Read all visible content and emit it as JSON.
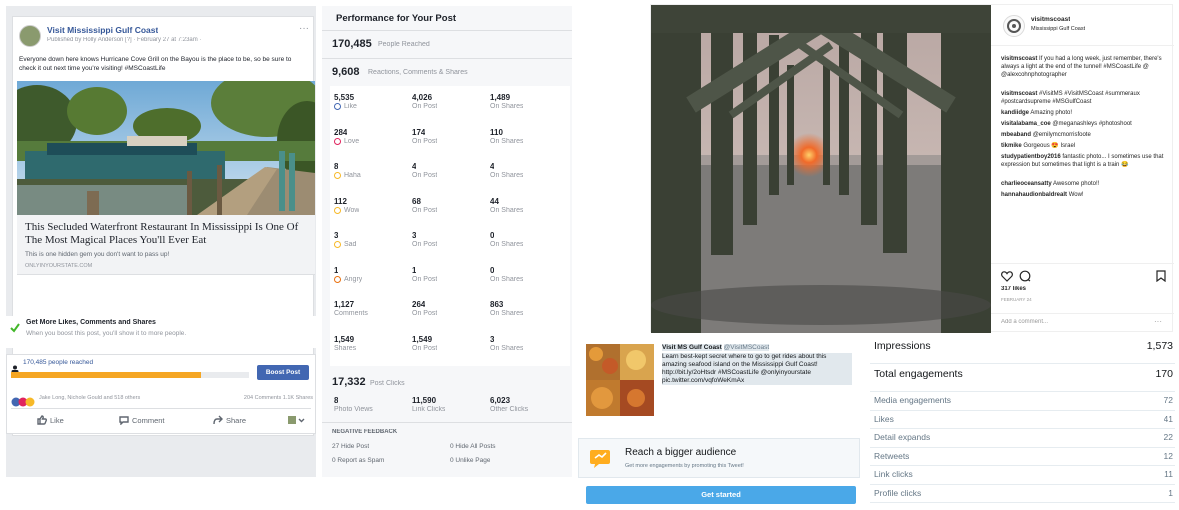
{
  "facebook": {
    "page_name": "Visit Mississippi Gulf Coast",
    "byline": "Published by Holly Anderson [?] · February 27 at 7:23am · ",
    "post_text": "Everyone down here knows Hurricane Cove Grill on the Bayou is the place to be, so be sure to check it out next time you're visiting! #MSCoastLife",
    "link_title": "This Secluded Waterfront Restaurant In Mississippi Is One Of The Most Magical Places You'll Ever Eat",
    "link_desc": "This is one hidden gem you don't want to pass up!",
    "link_domain": "ONLYINYOURSTATE.COM",
    "promo_title": "Get More Likes, Comments and Shares",
    "promo_desc": "When you boost this post, you'll show it to more people.",
    "reach_text": "170,485 people reached",
    "boost_label": "Boost Post",
    "reactions_text": "Jake Long, Nichole Gould and 518 others",
    "comments_text": "204 Comments 1.1K Shares",
    "like_label": "Like",
    "comment_label": "Comment",
    "share_label": "Share",
    "reach_progress_pct": 80
  },
  "performance": {
    "header": "Performance for Your Post",
    "reached_value": "170,485",
    "reached_label": "People Reached",
    "engaged_value": "9,608",
    "engaged_label": "Reactions, Comments & Shares",
    "rows": [
      {
        "v1": "5,535",
        "l1": "Like",
        "v2": "4,026",
        "l2": "On Post",
        "v3": "1,489",
        "l3": "On Shares",
        "color": "#4267b2",
        "icon": "like-icon"
      },
      {
        "v1": "284",
        "l1": "Love",
        "v2": "174",
        "l2": "On Post",
        "v3": "110",
        "l3": "On Shares",
        "color": "#e0245e",
        "icon": "love-icon"
      },
      {
        "v1": "8",
        "l1": "Haha",
        "v2": "4",
        "l2": "On Post",
        "v3": "4",
        "l3": "On Shares",
        "color": "#f7b928",
        "icon": "haha-icon"
      },
      {
        "v1": "112",
        "l1": "Wow",
        "v2": "68",
        "l2": "On Post",
        "v3": "44",
        "l3": "On Shares",
        "color": "#f7b928",
        "icon": "wow-icon"
      },
      {
        "v1": "3",
        "l1": "Sad",
        "v2": "3",
        "l2": "On Post",
        "v3": "0",
        "l3": "On Shares",
        "color": "#f7b928",
        "icon": "sad-icon"
      },
      {
        "v1": "1",
        "l1": "Angry",
        "v2": "1",
        "l2": "On Post",
        "v3": "0",
        "l3": "On Shares",
        "color": "#e9710f",
        "icon": "angry-icon"
      },
      {
        "v1": "1,127",
        "l1": "Comments",
        "v2": "264",
        "l2": "On Post",
        "v3": "863",
        "l3": "On Shares",
        "color": "",
        "icon": ""
      },
      {
        "v1": "1,549",
        "l1": "Shares",
        "v2": "1,549",
        "l2": "On Post",
        "v3": "3",
        "l3": "On Shares",
        "color": "",
        "icon": ""
      }
    ],
    "clicks_value": "17,332",
    "clicks_label": "Post Clicks",
    "c1v": "8",
    "c1l": "Photo Views",
    "c2v": "11,590",
    "c2l": "Link Clicks",
    "c3v": "6,023",
    "c3l": "Other Clicks",
    "neg_title": "NEGATIVE FEEDBACK",
    "n1": "27 Hide Post",
    "n2": "0 Hide All Posts",
    "n3": "0 Report as Spam",
    "n4": "0 Unlike Page"
  },
  "instagram": {
    "username": "visitmscoast",
    "location": "Mississippi Gulf Coast",
    "comments": [
      {
        "u": "visitmscoast",
        "t": "If you had a long week, just remember, there's always a light at the end of the tunnel! #MSCoastLife @ @alexcohnphotographer"
      },
      {
        "u": "visitmscoast",
        "t": "#VisitMS #VisitMSCoast #summeraux #postcardsupreme #MSGulfCoast"
      },
      {
        "u": "kandiidge",
        "t": "Amazing photo!"
      },
      {
        "u": "visitalabama_coe",
        "t": "@meganashleys #photoshoot"
      },
      {
        "u": "mbeaband",
        "t": "@emilymcmorrisfoote"
      },
      {
        "u": "tikmike",
        "t": "Gorgeous 😍 Israel"
      },
      {
        "u": "studypatientboy2016",
        "t": "fantastic photo... I sometimes use that expression but sometimes that light is a train 😂"
      },
      {
        "u": "charlieoceansatty",
        "t": "Awesome photo!!"
      },
      {
        "u": "hannahaudionbaldrealt",
        "t": "Wow!"
      }
    ],
    "likes": "317 likes",
    "date": "FEBRUARY 24",
    "add_comment": "Add a comment..."
  },
  "twitter": {
    "handle_name": "Visit MS Gulf Coast",
    "handle_at": "@VisitMSCoast",
    "tweet": "Learn best-kept secret where to go to get rides about this amazing seafood island on the Mississippi Gulf Coast! http://bit.ly/2oHtsdr #MSCoastLife @onlyinyourstate pic.twitter.com/vqfoWeKmAx",
    "reach_title": "Reach a bigger audience",
    "reach_desc": "Get more engagements by promoting this Tweet!",
    "cta": "Get started"
  },
  "tweet_stats": [
    {
      "label": "Impressions",
      "value": "1,573",
      "big": true
    },
    {
      "label": "Total engagements",
      "value": "170",
      "big": true
    },
    {
      "label": "Media engagements",
      "value": "72",
      "big": false
    },
    {
      "label": "Likes",
      "value": "41",
      "big": false
    },
    {
      "label": "Detail expands",
      "value": "22",
      "big": false
    },
    {
      "label": "Retweets",
      "value": "12",
      "big": false
    },
    {
      "label": "Link clicks",
      "value": "11",
      "big": false
    },
    {
      "label": "Profile clicks",
      "value": "1",
      "big": false
    }
  ]
}
